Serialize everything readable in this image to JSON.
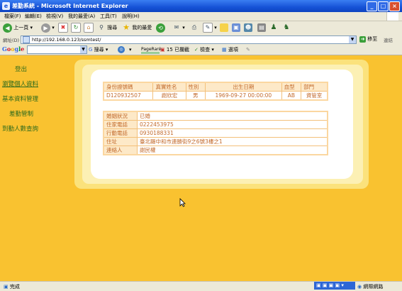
{
  "window": {
    "title": "差勤系統 - Microsoft Internet Explorer",
    "minimize": "_",
    "maximize": "□",
    "close": "×"
  },
  "menu": [
    "檔案(F)",
    "編輯(E)",
    "檢視(V)",
    "我的最愛(A)",
    "工具(T)",
    "說明(H)"
  ],
  "toolbar": {
    "back": "上一頁",
    "search": "搜尋",
    "favorites": "我的最愛"
  },
  "address": {
    "label": "網址(D)",
    "url": "http://192.168.0.123/ssmtest/",
    "go": "移至",
    "links": "連結"
  },
  "googlebar": {
    "logo": "Google",
    "search": "搜尋",
    "pagerank": "PageRank",
    "blocked": "15 已攔截",
    "check": "檢查",
    "options": "選項"
  },
  "nav": {
    "logout": "登出",
    "personal": "瀏覽個人資料",
    "basic": "基本資料管理",
    "attendance": "差勤管制",
    "arrival": "到勤人數查詢"
  },
  "table1": {
    "headers": [
      "身份證號碼",
      "真實姓名",
      "性別",
      "出生日期",
      "血型",
      "部門"
    ],
    "row": [
      "D120932507",
      "謝欣宏",
      "男",
      "1969-09-27 00:00:00",
      "AB",
      "資管室"
    ]
  },
  "table2": {
    "rows": [
      [
        "婚姻狀況",
        "已婚"
      ],
      [
        "住家電話",
        "0222453975"
      ],
      [
        "行動電話",
        "0930188331"
      ],
      [
        "住址",
        "臺北縣中和市連勝街9之6號3樓之1"
      ],
      [
        "連絡人",
        "謝民權"
      ]
    ]
  },
  "status": {
    "done": "完成",
    "zone": "網際網路"
  },
  "colors": {
    "background": "#f9c230",
    "nav_text": "#2d6a1c",
    "table_text": "#c26a2c",
    "table_border": "#f3c07a",
    "label_bg": "#fde9c8"
  }
}
